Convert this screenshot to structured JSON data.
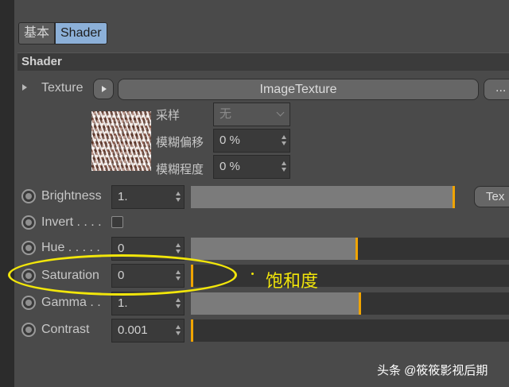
{
  "tabs": [
    {
      "label": "基本",
      "active": false
    },
    {
      "label": "Shader",
      "active": true
    }
  ],
  "section": {
    "title": "Shader"
  },
  "texture": {
    "label": "Texture",
    "image_button_label": "ImageTexture",
    "more_button_label": "..."
  },
  "sampling": {
    "label": "采样",
    "value": "无"
  },
  "blur_offset": {
    "label": "模糊偏移",
    "value": "0 %"
  },
  "blur_degree": {
    "label": "模糊程度",
    "value": "0 %"
  },
  "params": {
    "brightness": {
      "label": "Brightness",
      "value": "1.",
      "level": 1.0
    },
    "invert": {
      "label": "Invert . . . .",
      "checked": false
    },
    "hue": {
      "label": "Hue . . . . .",
      "value": "0",
      "level": 0.5
    },
    "saturation": {
      "label": "Saturation",
      "value": "0",
      "level": 0.0
    },
    "gamma": {
      "label": "Gamma . .",
      "value": "1.",
      "level": 0.5
    },
    "contrast": {
      "label": "Contrast",
      "value": "0.001",
      "level": 0.0
    }
  },
  "texture_side_button_label": "Tex",
  "annotation": {
    "text": "饱和度",
    "color": "#f2e60a"
  },
  "watermark": "头条 @筱筱影视后期",
  "colors": {
    "accent_handle": "#f0a400",
    "active_tab": "#8cb0d8"
  }
}
